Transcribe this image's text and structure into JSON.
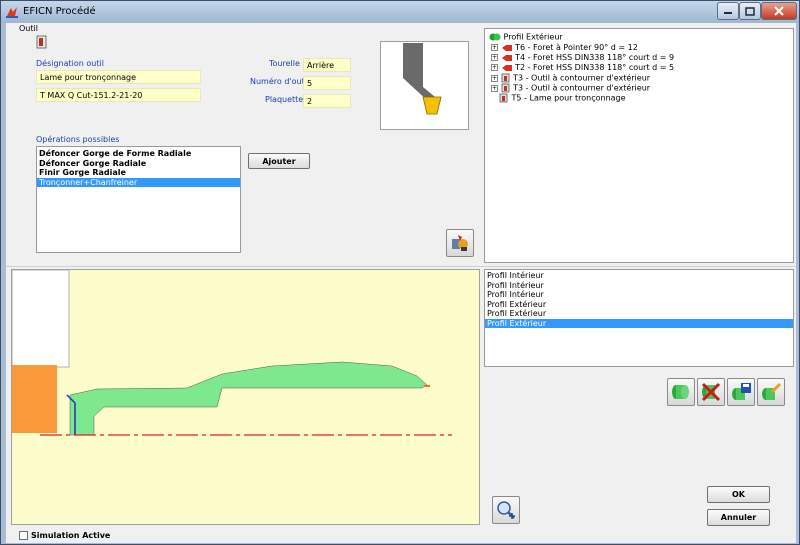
{
  "window": {
    "title": "EFICN Procédé"
  },
  "outil": {
    "group_label": "Outil",
    "designation_label": "Désignation outil",
    "designation_value": "Lame pour tronçonnage",
    "reference_value": "T MAX Q Cut-151.2-21-20",
    "tourelle_label": "Tourelle",
    "tourelle_value": "Arrière",
    "numero_label": "Numéro d'outil",
    "numero_value": "5",
    "plaquette_label": "Plaquette",
    "plaquette_value": "2"
  },
  "operations": {
    "label": "Opérations possibles",
    "items": [
      "Défoncer Gorge de Forme Radiale",
      "Défoncer Gorge Radiale",
      "Finir Gorge Radiale",
      "Tronçonner+Chanfreiner"
    ],
    "selected_index": 3,
    "add_label": "Ajouter"
  },
  "tree": {
    "root": "Profil Extérieur",
    "items": [
      "T6 - Foret à Pointer 90° d = 12",
      "T4 - Foret HSS DIN338 118° court d = 9",
      "T2 - Foret HSS DIN338 118° court d = 5",
      "T3 - Outil à contourner d'extérieur",
      "T3 - Outil à contourner d'extérieur",
      "T5 - Lame pour tronçonnage"
    ]
  },
  "profiles": {
    "items": [
      "Profil Intérieur",
      "Profil Intérieur",
      "Profil Intérieur",
      "Profil Extérieur",
      "Profil Extérieur",
      "Profil Extérieur"
    ],
    "selected_index": 5
  },
  "buttons": {
    "ok": "OK",
    "cancel": "Annuler"
  },
  "simulation": {
    "label": "Simulation Active",
    "checked": false
  },
  "icons": {
    "app": "app-icon",
    "tool": "tool-thumb-icon",
    "tool_preview": "tool-preview-icon",
    "palette": "tool-palette-icon",
    "zoom": "zoom-in-icon",
    "add_profile": "add-profile-icon",
    "delete_profile": "delete-profile-icon",
    "save_profile": "save-profile-icon",
    "edit_profile": "edit-profile-icon"
  },
  "colors": {
    "selection": "#3399ff",
    "canvas_bg": "#fdfdcc",
    "part_fill": "#7ee88e",
    "stock_fill": "#f89a3a",
    "axis_line": "#e02020",
    "field_bg": "#ffffc8",
    "label_blue": "#1a3fae"
  }
}
